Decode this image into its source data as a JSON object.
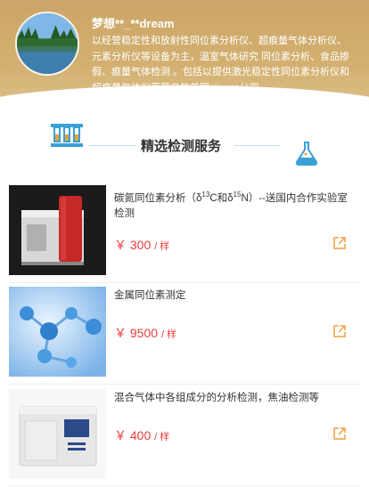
{
  "shop": {
    "name": "梦想**_**dream",
    "description": "以经营稳定性和放射性同位素分析仪、超痕量气体分析仪、元素分析仪等设备为主，温室气体研究 同位素分析、食品掺假、痕量气体检测 。包括以提供激光稳定性同位素分析仪和超痕量气体仪而著名的美国picarro公司..."
  },
  "section": {
    "title": "精选检测服务"
  },
  "services": [
    {
      "name_prefix": "碳氮同位素分析（δ",
      "sup1": "13",
      "mid": "C和δ",
      "sup2": "15",
      "name_suffix": "N）--送国内合作实验室检测",
      "price": "￥ 300",
      "unit": "/ 样"
    },
    {
      "name": "金属同位素测定",
      "price": "￥ 9500",
      "unit": "/ 样"
    },
    {
      "name": "混合气体中各组成分的分析检测，焦油检测等",
      "price": "￥ 400",
      "unit": "/ 样"
    }
  ],
  "colors": {
    "price": "#e83d3d",
    "accent_orange": "#f0a040",
    "header_gold": "#cba567"
  },
  "icons": [
    "lab-tubes-icon",
    "flask-icon",
    "share-icon"
  ]
}
